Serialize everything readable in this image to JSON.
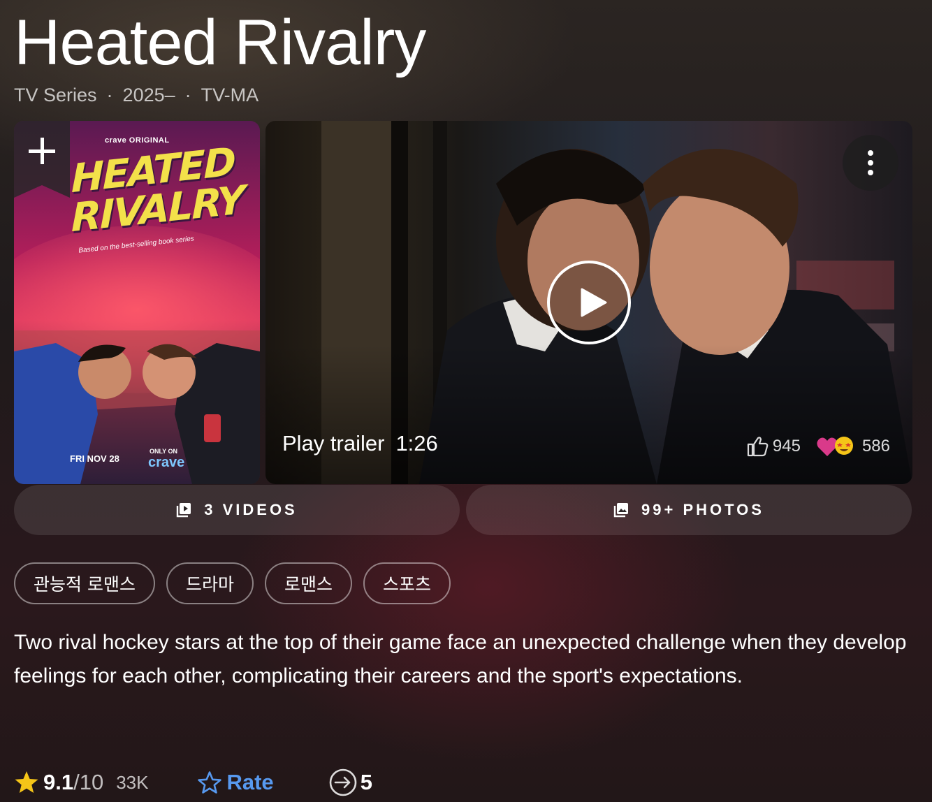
{
  "title": "Heated Rivalry",
  "meta": {
    "type": "TV Series",
    "years": "2025–",
    "rating": "TV-MA"
  },
  "poster": {
    "brand": "crave ORIGINAL",
    "title_line1": "HEATED",
    "title_line2": "RIVALRY",
    "tagline": "Based on the best-selling book series",
    "date": "FRI NOV 28",
    "only_on": "ONLY ON",
    "brand2": "crave",
    "add_icon": "plus-icon"
  },
  "trailer": {
    "label": "Play trailer",
    "duration": "1:26",
    "likes": "945",
    "loves": "586",
    "more_icon": "more-vert-icon"
  },
  "media": {
    "videos_label": "3 VIDEOS",
    "photos_label": "99+ PHOTOS"
  },
  "genres": [
    "관능적 로맨스",
    "드라마",
    "로맨스",
    "스포츠"
  ],
  "plot": "Two rival hockey stars at the top of their game face an unexpected challenge when they develop feelings for each other, complicating their careers and the sport's expectations.",
  "rating": {
    "score": "9.1",
    "max": "/10",
    "votes": "33K",
    "rate_label": "Rate",
    "popularity": "5"
  },
  "colors": {
    "accent_star": "#f5c518",
    "rate_blue": "#5799ef",
    "poster_yellow": "#f3e14a"
  }
}
